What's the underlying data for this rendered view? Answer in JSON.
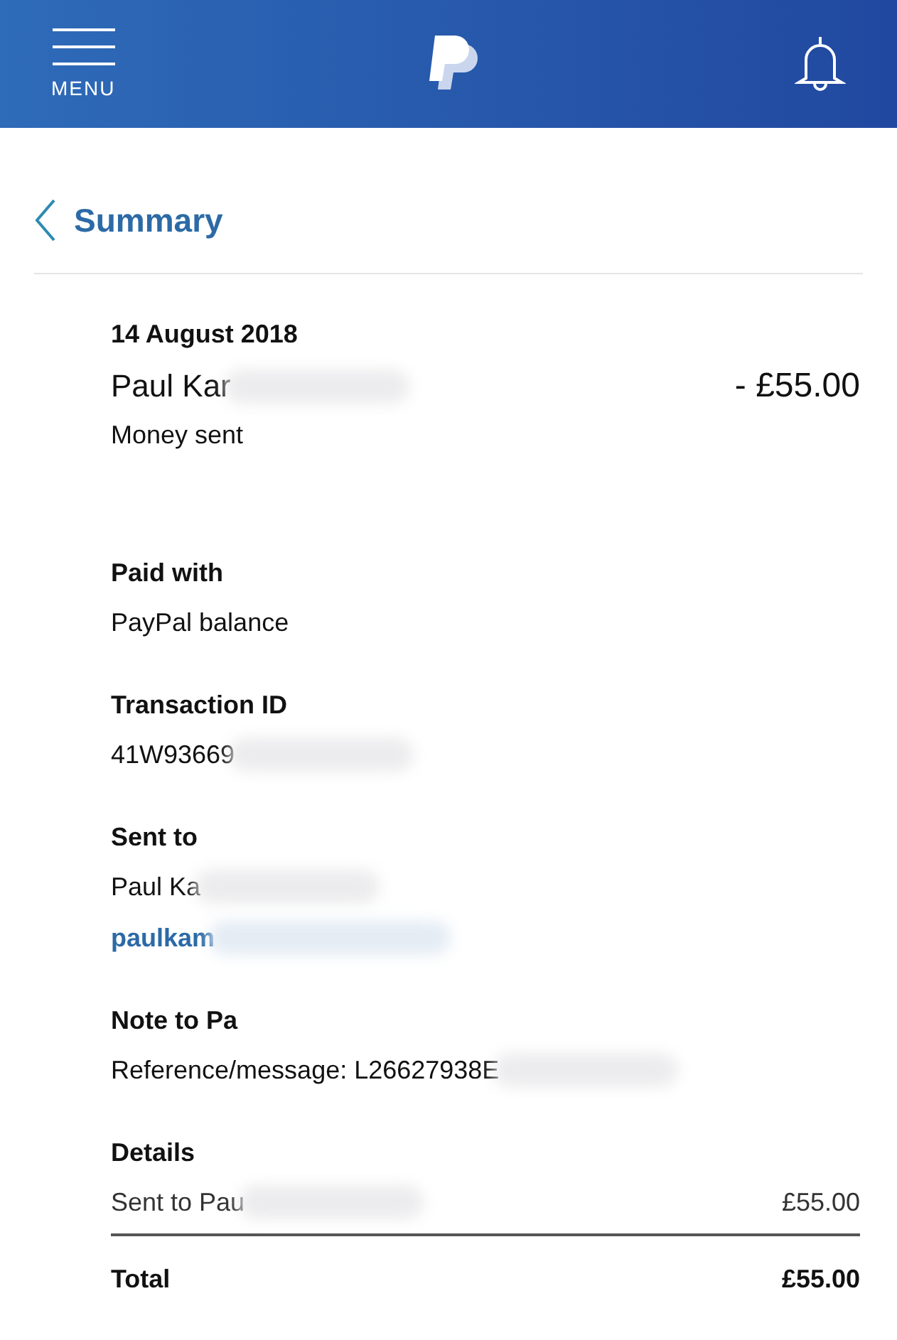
{
  "header": {
    "menu_label": "MENU"
  },
  "page": {
    "title": "Summary"
  },
  "transaction": {
    "date": "14 August 2018",
    "name": "Paul Kar",
    "amount": "- £55.00",
    "type": "Money sent"
  },
  "sections": [
    {
      "kind": "text",
      "label": "Paid with",
      "lines": [
        "PayPal balance"
      ]
    },
    {
      "kind": "text",
      "label": "Transaction ID",
      "lines": [
        "41W93669"
      ]
    },
    {
      "kind": "contact",
      "label": "Sent to",
      "lines": [
        "Paul Ka"
      ],
      "email": "paulkam"
    },
    {
      "kind": "text",
      "label": "Note to Pa",
      "lines": [
        "Reference/message: L26627938E"
      ]
    }
  ],
  "details": {
    "label": "Details",
    "items": [
      {
        "description": "Sent to Pau",
        "amount": "£55.00"
      }
    ],
    "total_label": "Total",
    "total": "£55.00"
  }
}
